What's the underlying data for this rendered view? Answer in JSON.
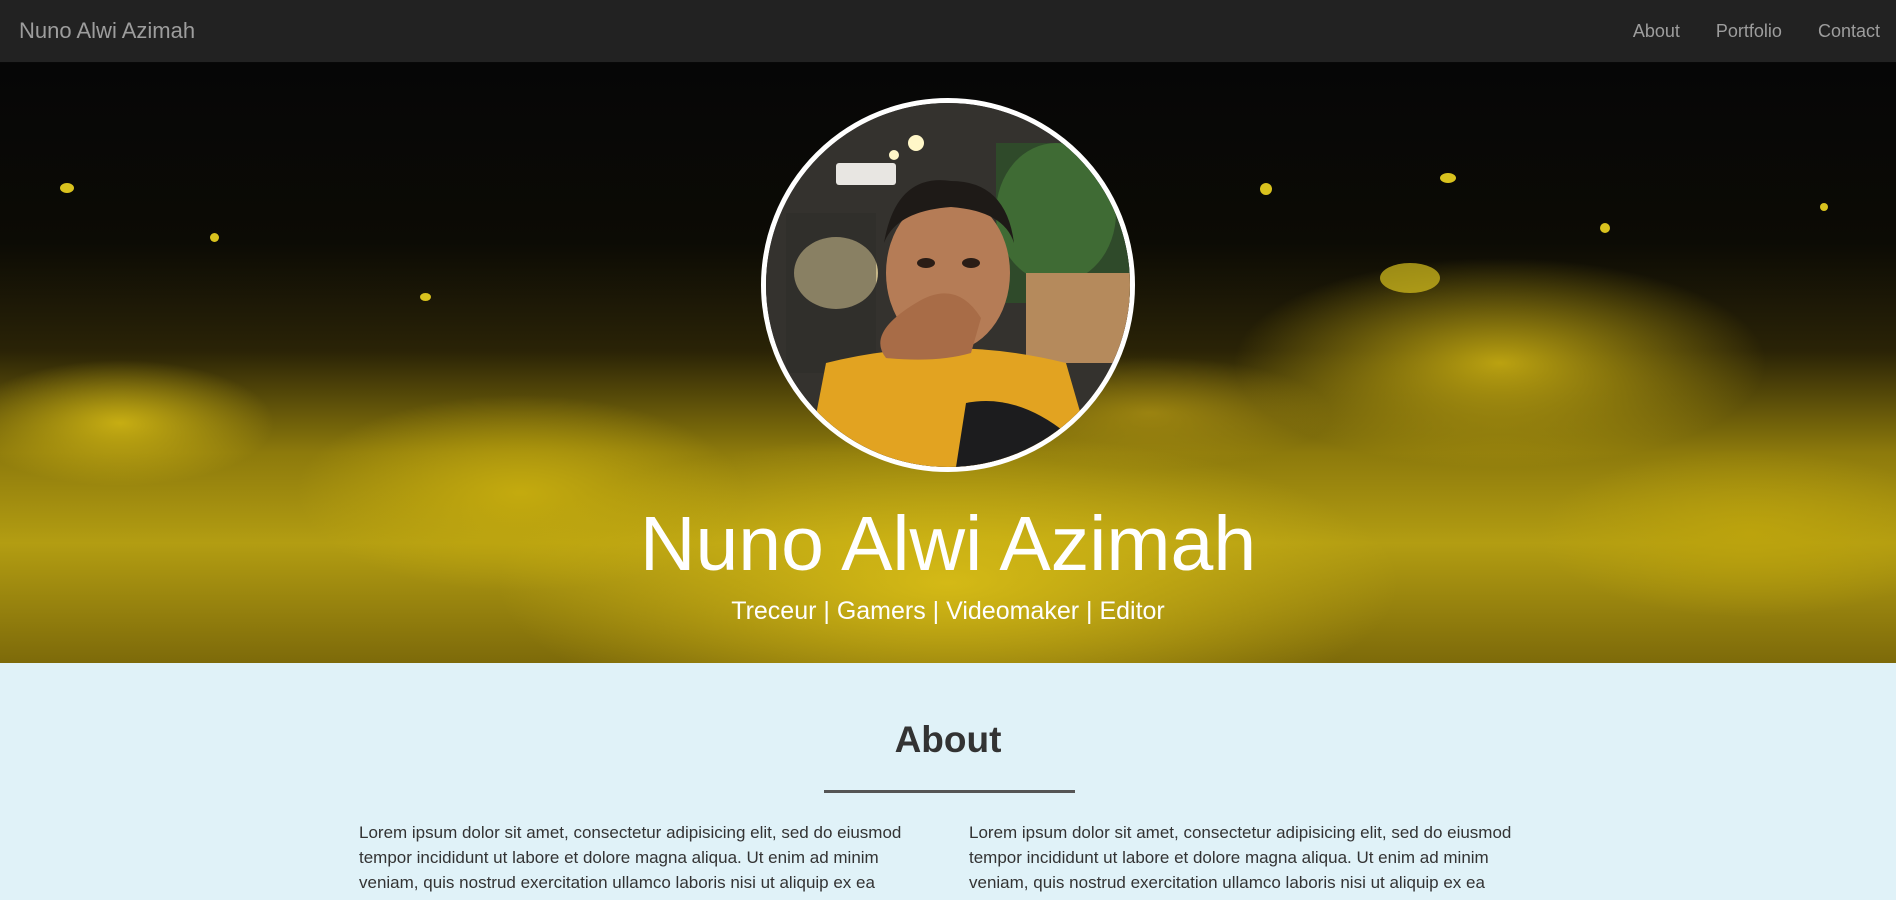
{
  "navbar": {
    "brand": "Nuno Alwi Azimah",
    "links": [
      "About",
      "Portfolio",
      "Contact"
    ]
  },
  "hero": {
    "name": "Nuno Alwi Azimah",
    "tagline": "Treceur | Gamers | Videomaker | Editor",
    "photo_icon": "profile-photo"
  },
  "about": {
    "title": "About",
    "paragraphs": [
      "Lorem ipsum dolor sit amet, consectetur adipisicing elit, sed do eiusmod tempor incididunt ut labore et dolore magna aliqua. Ut enim ad minim veniam, quis nostrud exercitation ullamco laboris nisi ut aliquip ex ea",
      "Lorem ipsum dolor sit amet, consectetur adipisicing elit, sed do eiusmod tempor incididunt ut labore et dolore magna aliqua. Ut enim ad minim veniam, quis nostrud exercitation ullamco laboris nisi ut aliquip ex ea"
    ]
  },
  "colors": {
    "navbar_bg": "#222222",
    "nav_text": "#9d9d9d",
    "about_bg": "#e0f2f8",
    "accent_yellow": "#d9c21e"
  }
}
